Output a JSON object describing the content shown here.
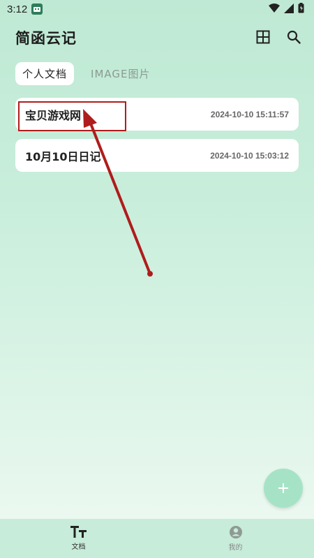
{
  "status_bar": {
    "time": "3:12"
  },
  "header": {
    "title": "简函云记"
  },
  "tabs": [
    {
      "label": "个人文档",
      "active": true
    },
    {
      "label": "IMAGE图片",
      "active": false
    }
  ],
  "documents": [
    {
      "title": "宝贝游戏网",
      "time": "2024-10-10 15:11:57"
    },
    {
      "title": "10月10日日记",
      "time": "2024-10-10 15:03:12"
    }
  ],
  "bottom_nav": [
    {
      "label": "文档",
      "icon": "text-format-icon",
      "active": true
    },
    {
      "label": "我的",
      "icon": "profile-icon",
      "active": false
    }
  ],
  "colors": {
    "accent": "#a6e3c6",
    "annotation": "#b01c1c",
    "background_top": "#bfe9d4"
  }
}
